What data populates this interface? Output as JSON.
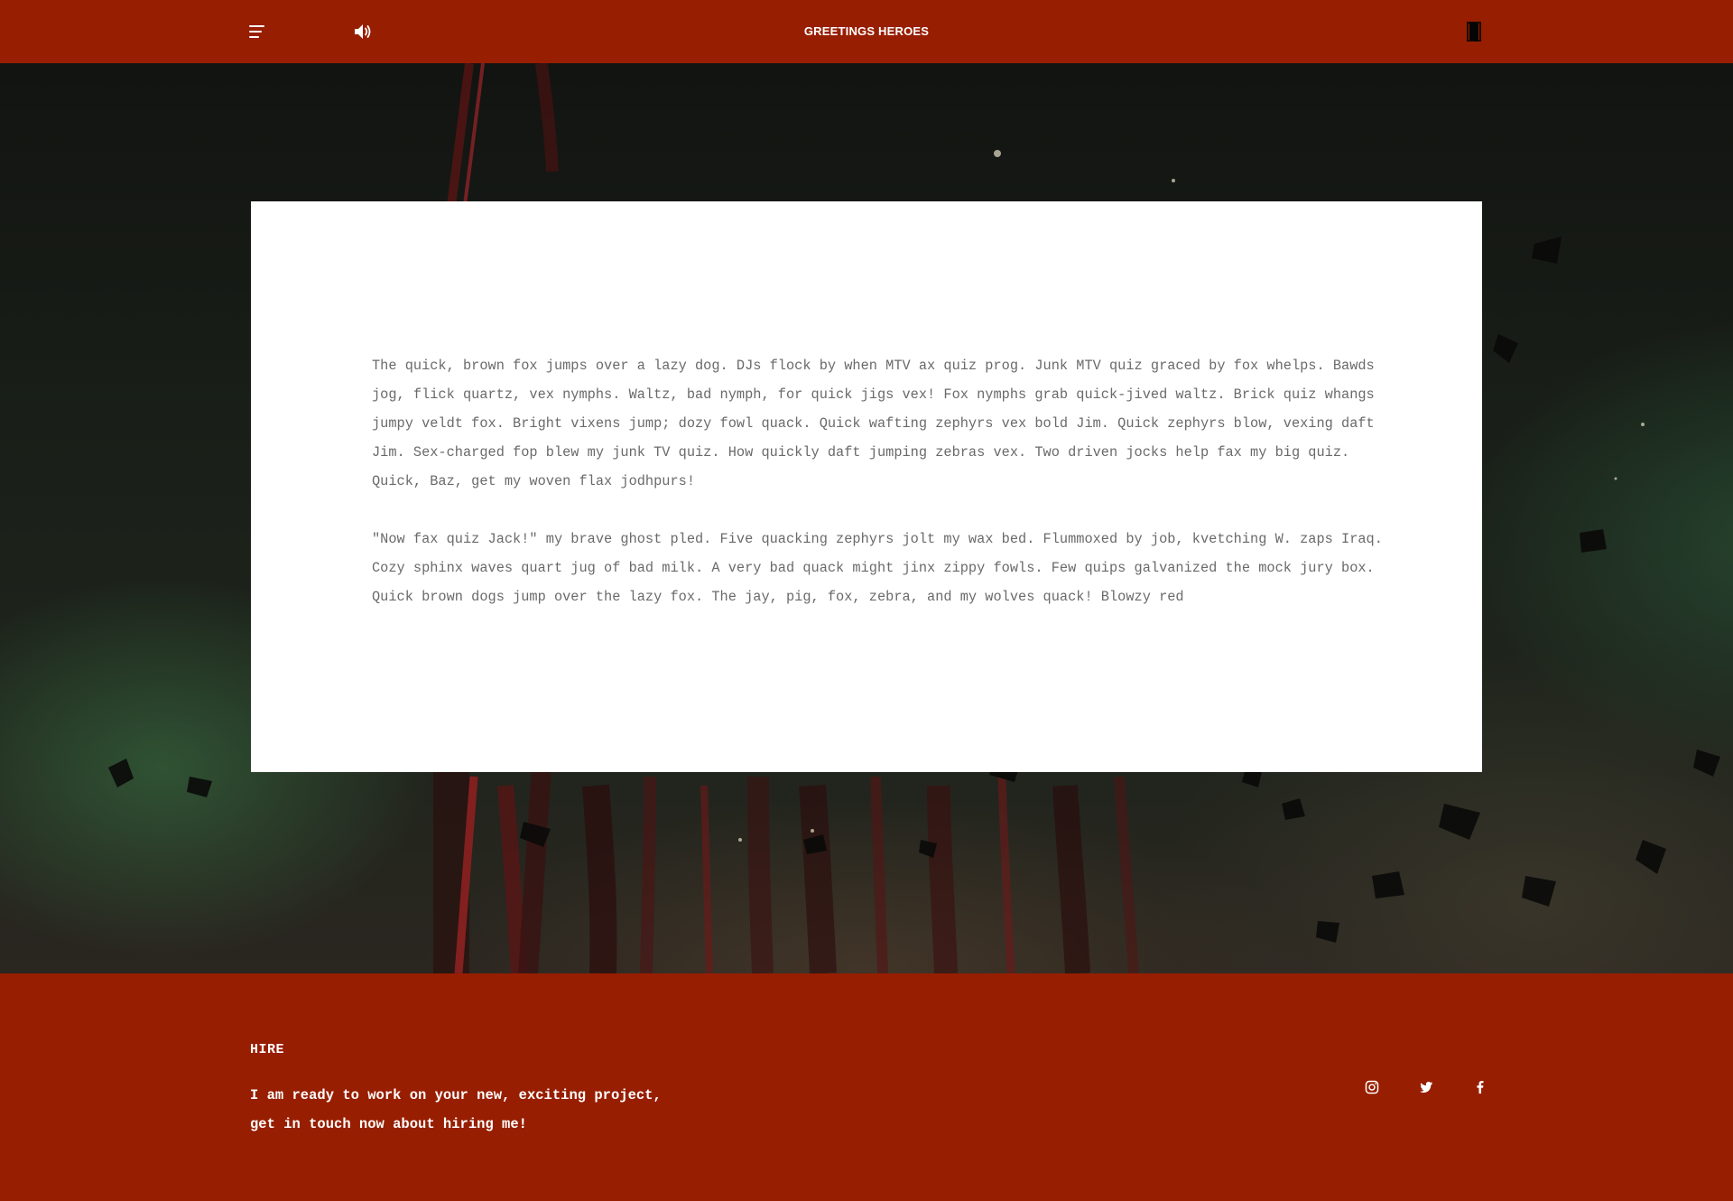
{
  "header": {
    "title": "GREETINGS HEROES",
    "icons": [
      "menu-icon",
      "speaker-icon",
      "door-exit-icon"
    ]
  },
  "content": {
    "paragraphs": [
      "The quick, brown fox jumps over a lazy dog. DJs flock by when MTV ax quiz prog. Junk MTV quiz graced by fox whelps. Bawds jog, flick quartz, vex nymphs. Waltz, bad nymph, for quick jigs vex! Fox nymphs grab quick-jived waltz. Brick quiz whangs jumpy veldt fox. Bright vixens jump; dozy fowl quack. Quick wafting zephyrs vex bold Jim. Quick zephyrs blow, vexing daft Jim. Sex-charged fop blew my junk TV quiz. How quickly daft jumping zebras vex. Two driven jocks help fax my big quiz. Quick, Baz, get my woven flax jodhpurs!",
      "\"Now fax quiz Jack!\" my brave ghost pled. Five quacking zephyrs jolt my wax bed. Flummoxed by job, kvetching W. zaps Iraq. Cozy sphinx waves quart jug of bad milk. A very bad quack might jinx zippy fowls. Few quips galvanized the mock jury box. Quick brown dogs jump over the lazy fox. The jay, pig, fox, zebra, and my wolves quack! Blowzy red"
    ]
  },
  "footer": {
    "hire_title": "HIRE",
    "hire_line1": "I am ready to work on your new, exciting project,",
    "hire_line2": "get in touch now about hiring me!",
    "social": [
      "instagram-icon",
      "twitter-icon",
      "facebook-icon"
    ]
  },
  "colors": {
    "brand_red": "#981e01",
    "card_bg": "#ffffff",
    "body_text": "#6a6a6a"
  }
}
